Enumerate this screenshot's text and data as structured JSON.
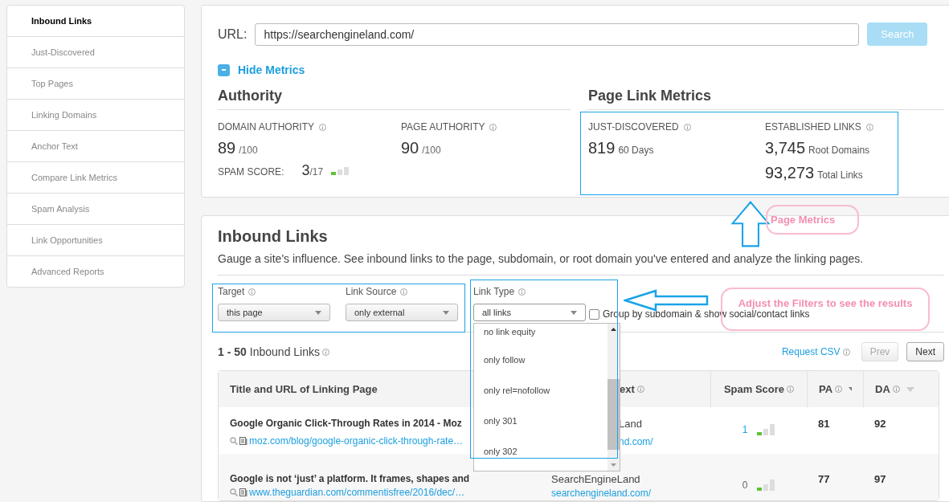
{
  "sidebar": {
    "items": [
      {
        "label": "Inbound Links",
        "selected": true
      },
      {
        "label": "Just-Discovered",
        "selected": false
      },
      {
        "label": "Top Pages",
        "selected": false
      },
      {
        "label": "Linking Domains",
        "selected": false
      },
      {
        "label": "Anchor Text",
        "selected": false
      },
      {
        "label": "Compare Link Metrics",
        "selected": false
      },
      {
        "label": "Spam Analysis",
        "selected": false
      },
      {
        "label": "Link Opportunities",
        "selected": false
      },
      {
        "label": "Advanced Reports",
        "selected": false
      }
    ]
  },
  "url_bar": {
    "label": "URL:",
    "value": "https://searchengineland.com/",
    "button": "Search",
    "button_disabled": true
  },
  "metrics_toggle": {
    "label": "Hide Metrics",
    "expanded": true
  },
  "authority": {
    "title": "Authority",
    "domain_authority": {
      "label": "DOMAIN AUTHORITY",
      "value": "89",
      "suffix": "/100"
    },
    "page_authority": {
      "label": "PAGE AUTHORITY",
      "value": "90",
      "suffix": "/100"
    },
    "spam_score": {
      "label": "SPAM SCORE:",
      "value": "3",
      "suffix": "/17"
    }
  },
  "page_link_metrics": {
    "title": "Page Link Metrics",
    "just_discovered": {
      "label": "JUST-DISCOVERED",
      "value": "819",
      "unit": "60 Days"
    },
    "established_links": {
      "label": "ESTABLISHED LINKS",
      "rows": [
        {
          "value": "3,745",
          "unit": "Root Domains"
        },
        {
          "value": "93,273",
          "unit": "Total Links"
        }
      ]
    }
  },
  "inbound": {
    "title": "Inbound Links",
    "description": "Gauge a site's influence. See inbound links to the page, subdomain, or root domain you've entered and analyze the linking pages.",
    "filters": [
      {
        "label": "Target",
        "value": "this page"
      },
      {
        "label": "Link Source",
        "value": "only external"
      }
    ],
    "link_type": {
      "label": "Link Type",
      "value": "all links",
      "expanded": true,
      "options": [
        "no link equity",
        "only follow",
        "only rel=nofollow",
        "only 301",
        "only 302"
      ]
    },
    "group_checkbox": {
      "label": "Group by subdomain & show social/contact links",
      "checked": false
    },
    "results": {
      "range": "1 - 50",
      "label": "Inbound Links"
    },
    "request_csv": "Request CSV",
    "buttons": [
      {
        "label": "Prev",
        "disabled": true
      },
      {
        "label": "Next",
        "disabled": false
      }
    ],
    "table": {
      "columns": [
        {
          "label": "Title and URL of Linking Page"
        },
        {
          "label": "ext",
          "info": true
        },
        {
          "label": "Spam Score",
          "info": true
        },
        {
          "label": "PA",
          "info": true,
          "sort_active": true
        },
        {
          "label": "DA",
          "info": true,
          "sort_active": false
        }
      ],
      "rows": [
        {
          "title": "Google Organic Click-Through Rates in 2014 - Moz",
          "url": "moz.com/blog/google-organic-click-through-rate…",
          "site": "Land",
          "domain": "nd.com/",
          "spam": "1",
          "spam_linked": true,
          "pa": "81",
          "da": "92"
        },
        {
          "title": "Google is not ‘just’ a platform. It frames, shapes and",
          "url": "www.theguardian.com/commentisfree/2016/dec/…",
          "site": "SearchEngineLand",
          "domain": "searchengineland.com/",
          "spam": "0",
          "spam_linked": false,
          "pa": "77",
          "da": "97"
        }
      ]
    }
  },
  "annotations": [
    {
      "text": "Page Metrics"
    },
    {
      "text": "Adjust the Filters to see the results"
    }
  ]
}
